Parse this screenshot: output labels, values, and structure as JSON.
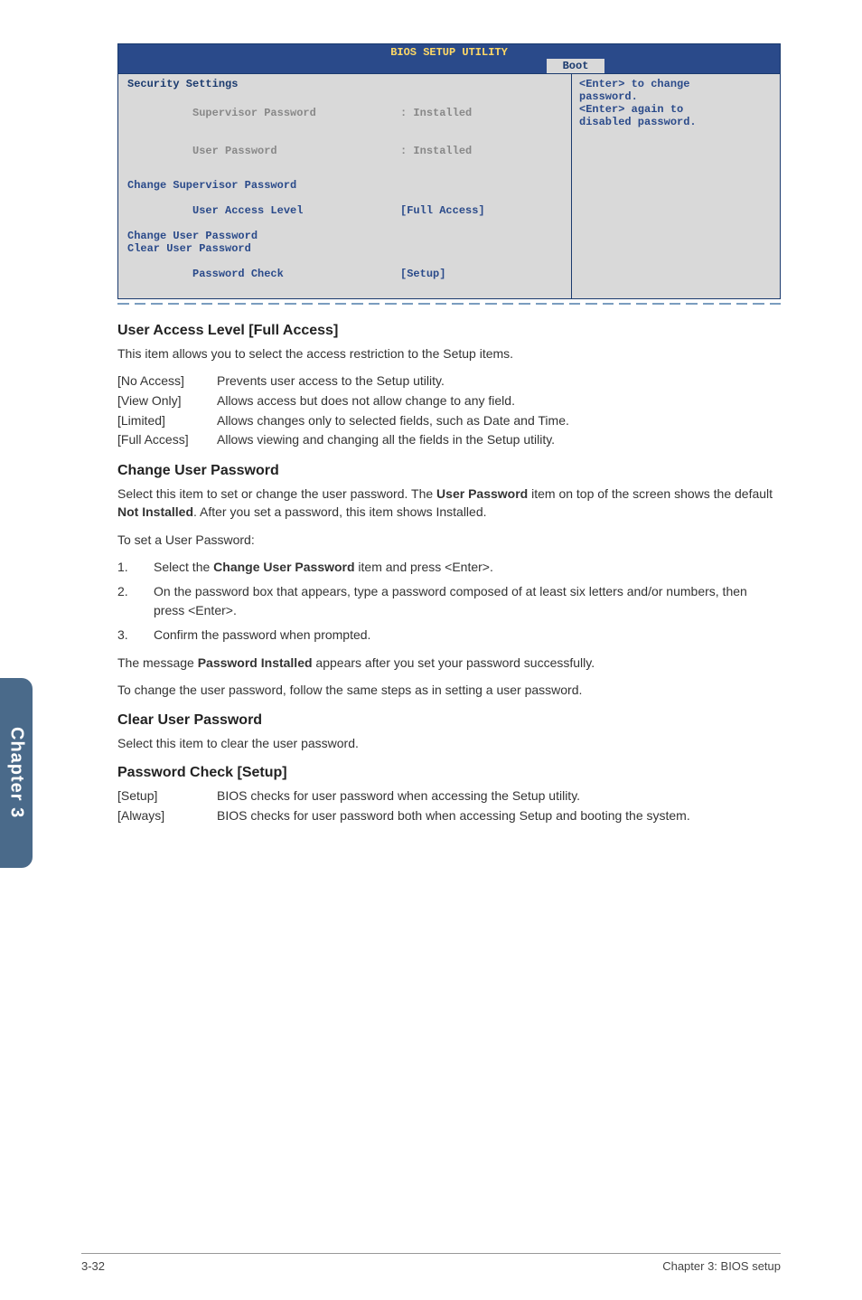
{
  "bios": {
    "title": "BIOS SETUP UTILITY",
    "tab": "Boot",
    "left": {
      "heading": "Security Settings",
      "supervisor_label": "Supervisor Password",
      "supervisor_value": ": Installed",
      "user_label": "User Password",
      "user_value": ": Installed",
      "change_supervisor": "Change Supervisor Password",
      "user_access_label": "User Access Level",
      "user_access_value": "[Full Access]",
      "change_user": "Change User Password",
      "clear_user": "Clear User Password",
      "pw_check_label": "Password Check",
      "pw_check_value": "[Setup]"
    },
    "right": {
      "line1": "<Enter> to change",
      "line2": "password.",
      "line3": "<Enter> again to",
      "line4": "disabled password."
    }
  },
  "section1": {
    "heading": "User Access Level [Full Access]",
    "intro": "This item allows you to select the access restriction to the Setup items.",
    "defs": [
      {
        "k": "[No Access]",
        "v": "Prevents user access to the Setup utility."
      },
      {
        "k": "[View Only]",
        "v": "Allows access but does not allow change to any field."
      },
      {
        "k": "[Limited]",
        "v": "Allows changes only to selected fields, such as Date and Time."
      },
      {
        "k": "[Full Access]",
        "v": "Allows viewing and changing all the fields in the Setup utility."
      }
    ]
  },
  "section2": {
    "heading": "Change User Password",
    "p1a": "Select this item to set or change the user password. The ",
    "p1b": "User Password",
    "p1c": " item on top of the screen shows the default ",
    "p1d": "Not Installed",
    "p1e": ". After you set a password, this item shows Installed.",
    "p2": "To set a User Password:",
    "steps": [
      {
        "n": "1.",
        "t_a": "Select the ",
        "t_b": "Change User Password",
        "t_c": " item and press <Enter>."
      },
      {
        "n": "2.",
        "t_a": "On the password box that appears, type a password composed of at least six letters and/or numbers, then press <Enter>.",
        "t_b": "",
        "t_c": ""
      },
      {
        "n": "3.",
        "t_a": "Confirm the password when prompted.",
        "t_b": "",
        "t_c": ""
      }
    ],
    "p3a": "The message ",
    "p3b": "Password Installed",
    "p3c": " appears after you set your password successfully.",
    "p4": "To change the user password, follow the same steps as in setting a user password."
  },
  "section3": {
    "heading": "Clear User Password",
    "p1": "Select this item to clear the user password."
  },
  "section4": {
    "heading": "Password Check [Setup]",
    "defs": [
      {
        "k": "[Setup]",
        "v": "BIOS checks for user password when accessing the Setup utility."
      },
      {
        "k": "[Always]",
        "v": "BIOS checks for user password both when accessing Setup and booting the system."
      }
    ]
  },
  "sidetab": "Chapter 3",
  "footer": {
    "left": "3-32",
    "right": "Chapter 3: BIOS setup"
  }
}
